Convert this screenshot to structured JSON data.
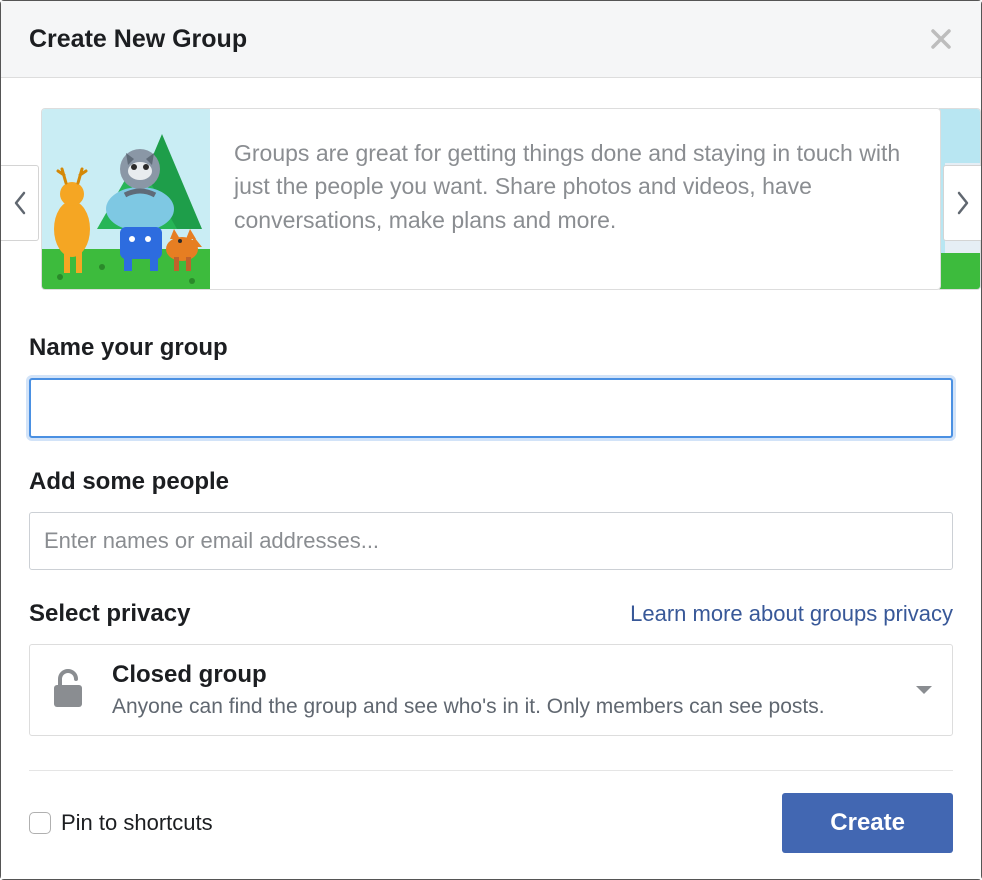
{
  "header": {
    "title": "Create New Group"
  },
  "carousel": {
    "description": "Groups are great for getting things done and staying in touch with just the people you want. Share photos and videos, have conversations, make plans and more."
  },
  "form": {
    "name_label": "Name your group",
    "name_value": "",
    "people_label": "Add some people",
    "people_placeholder": "Enter names or email addresses...",
    "people_value": ""
  },
  "privacy": {
    "section_label": "Select privacy",
    "learn_more": "Learn more about groups privacy",
    "selected": {
      "title": "Closed group",
      "description": "Anyone can find the group and see who's in it. Only members can see posts."
    }
  },
  "footer": {
    "pin_label": "Pin to shortcuts",
    "pin_checked": false,
    "create_label": "Create"
  }
}
